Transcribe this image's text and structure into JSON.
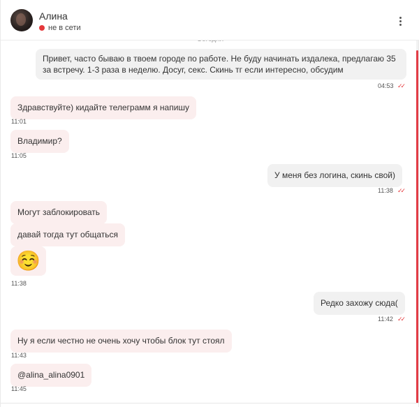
{
  "header": {
    "name": "Алина",
    "status": "не в сети",
    "status_color": "#e5383b",
    "menu_icon": "more-vertical-icon"
  },
  "date_separator": "Сегодня",
  "messages": [
    {
      "dir": "out",
      "text": "Привет, часто бываю в твоем городе по работе. Не буду начинать издалека, предлагаю 35 за встречу. 1-3 раза в неделю. Досуг, секс. Скинь тг если интересно, обсудим",
      "time": "04:53",
      "ticks": "✓✓"
    },
    {
      "dir": "in",
      "text": "Здравствуйте) кидайте телеграмм я напишу",
      "time": "11:01"
    },
    {
      "dir": "in",
      "text": "Владимир?",
      "time": "11:05"
    },
    {
      "dir": "out",
      "text": "У меня без логина, скинь свой)",
      "time": "11:38",
      "ticks": "✓✓"
    },
    {
      "dir": "in",
      "text": "Могут заблокировать"
    },
    {
      "dir": "in",
      "text": "давай тогда тут общаться"
    },
    {
      "dir": "in",
      "text": "☺️",
      "time": "11:38"
    },
    {
      "dir": "out",
      "text": "Редко захожу сюда(",
      "time": "11:42",
      "ticks": "✓✓"
    },
    {
      "dir": "in",
      "text": "Ну я если честно не очень хочу чтобы блок тут стоял",
      "time": "11:43"
    },
    {
      "dir": "in",
      "text": "@alina_alina0901",
      "time": "11:45"
    }
  ],
  "colors": {
    "accent": "#e5383b",
    "incoming_bubble": "#fbeeee",
    "outgoing_bubble": "#f1f1f1"
  }
}
